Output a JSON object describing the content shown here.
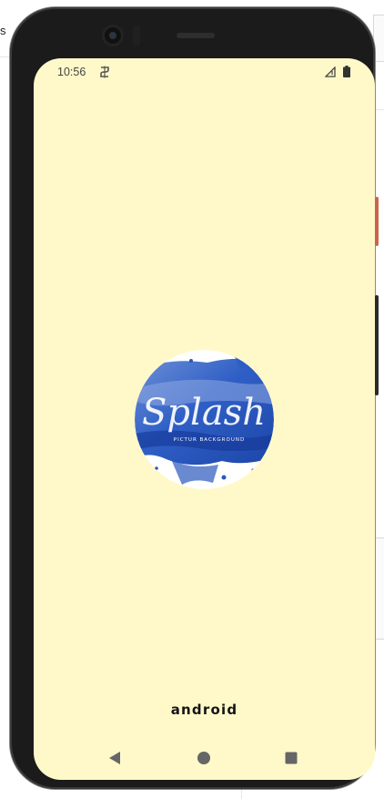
{
  "background": {
    "edge_text": "s"
  },
  "status_bar": {
    "time": "10:56",
    "icons": [
      "notification-icon",
      "signal-icon",
      "battery-icon"
    ]
  },
  "splash": {
    "logo_text": "Splash",
    "logo_subtext": "PICTUR BACKGROUND",
    "background_color": "#fff9c9",
    "accent_color": "#2a5bc4"
  },
  "footer": {
    "brand": "android"
  },
  "nav_bar": {
    "buttons": [
      "back-icon",
      "home-icon",
      "recents-icon"
    ]
  }
}
